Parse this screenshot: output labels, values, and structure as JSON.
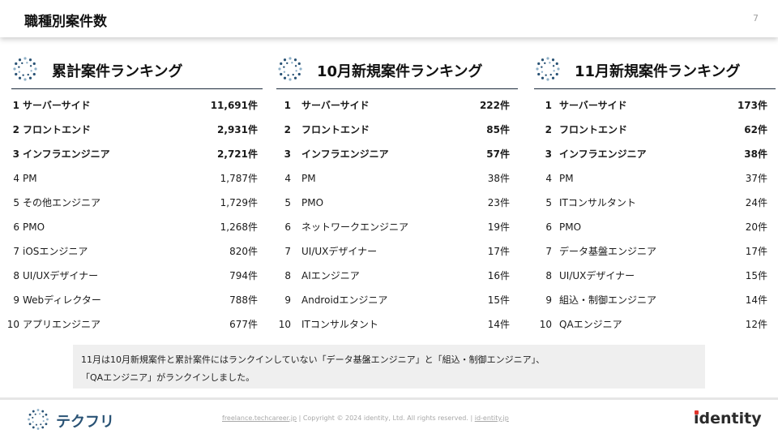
{
  "header": {
    "title": "職種別案件数",
    "page_number": "7"
  },
  "columns": [
    {
      "title": "累計案件ランキング",
      "rows": [
        {
          "rank": "1",
          "name": "サーバーサイド",
          "count": "11,691件",
          "bold": true
        },
        {
          "rank": "2",
          "name": "フロントエンド",
          "count": "2,931件",
          "bold": true
        },
        {
          "rank": "3",
          "name": "インフラエンジニア",
          "count": "2,721件",
          "bold": true
        },
        {
          "rank": "4",
          "name": "PM",
          "count": "1,787件",
          "bold": false
        },
        {
          "rank": "5",
          "name": "その他エンジニア",
          "count": "1,729件",
          "bold": false
        },
        {
          "rank": "6",
          "name": "PMO",
          "count": "1,268件",
          "bold": false
        },
        {
          "rank": "7",
          "name": "iOSエンジニア",
          "count": "820件",
          "bold": false
        },
        {
          "rank": "8",
          "name": "UI/UXデザイナー",
          "count": "794件",
          "bold": false
        },
        {
          "rank": "9",
          "name": "Webディレクター",
          "count": "788件",
          "bold": false
        },
        {
          "rank": "10",
          "name": "アプリエンジニア",
          "count": "677件",
          "bold": false
        }
      ]
    },
    {
      "title": "10月新規案件ランキング",
      "rows": [
        {
          "rank": "1",
          "name": "サーバーサイド",
          "count": "222件",
          "bold": true
        },
        {
          "rank": "2",
          "name": "フロントエンド",
          "count": "85件",
          "bold": true
        },
        {
          "rank": "3",
          "name": "インフラエンジニア",
          "count": "57件",
          "bold": true
        },
        {
          "rank": "4",
          "name": "PM",
          "count": "38件",
          "bold": false
        },
        {
          "rank": "5",
          "name": "PMO",
          "count": "23件",
          "bold": false
        },
        {
          "rank": "6",
          "name": "ネットワークエンジニア",
          "count": "19件",
          "bold": false
        },
        {
          "rank": "7",
          "name": "UI/UXデザイナー",
          "count": "17件",
          "bold": false
        },
        {
          "rank": "8",
          "name": "AIエンジニア",
          "count": "16件",
          "bold": false
        },
        {
          "rank": "9",
          "name": "Androidエンジニア",
          "count": "15件",
          "bold": false
        },
        {
          "rank": "10",
          "name": "ITコンサルタント",
          "count": "14件",
          "bold": false
        }
      ]
    },
    {
      "title": "11月新規案件ランキング",
      "rows": [
        {
          "rank": "1",
          "name": "サーバーサイド",
          "count": "173件",
          "bold": true
        },
        {
          "rank": "2",
          "name": "フロントエンド",
          "count": "62件",
          "bold": true
        },
        {
          "rank": "3",
          "name": "インフラエンジニア",
          "count": "38件",
          "bold": true
        },
        {
          "rank": "4",
          "name": "PM",
          "count": "37件",
          "bold": false
        },
        {
          "rank": "5",
          "name": "ITコンサルタント",
          "count": "24件",
          "bold": false
        },
        {
          "rank": "6",
          "name": "PMO",
          "count": "20件",
          "bold": false
        },
        {
          "rank": "7",
          "name": "データ基盤エンジニア",
          "count": "17件",
          "bold": false
        },
        {
          "rank": "8",
          "name": "UI/UXデザイナー",
          "count": "15件",
          "bold": false
        },
        {
          "rank": "9",
          "name": "組込・制御エンジニア",
          "count": "14件",
          "bold": false
        },
        {
          "rank": "10",
          "name": "QAエンジニア",
          "count": "12件",
          "bold": false
        }
      ]
    }
  ],
  "note": {
    "line1": "11月は10月新規案件と累計案件にはランクインしていない「データ基盤エンジニア」と「組込・制御エンジニア」、",
    "line2": "「QAエンジニア」がランクインしました。"
  },
  "footer": {
    "brand_name": "テクフリ",
    "site_link": "freelance.techcareer.jp",
    "copyright": "Copyright © 2024 identity, Ltd. All rights reserved.",
    "corp_link": "id-entity.jp",
    "separator": "|",
    "logo_first": "i",
    "logo_rest": "dentity"
  },
  "colors": {
    "accent_line": "#1b2a3a",
    "brand_blue": "#2a5375",
    "logo_red": "#e0342b",
    "note_bg": "#efefef"
  },
  "icons": {
    "column_icon": "dotted-circle-icon",
    "brand_icon": "dotted-circle-icon"
  }
}
